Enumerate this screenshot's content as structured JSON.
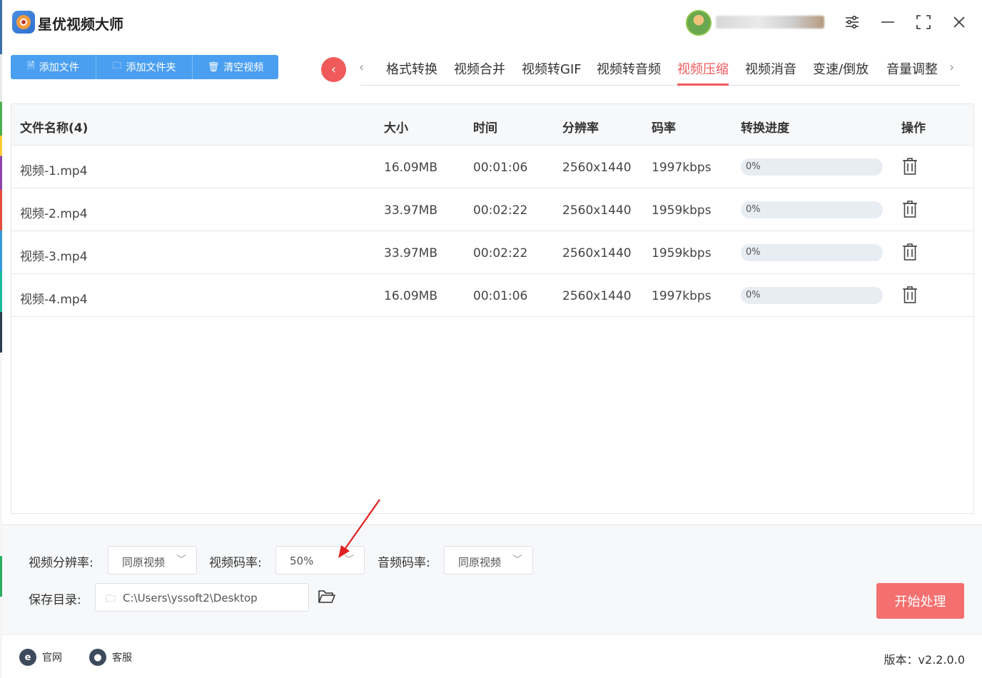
{
  "app": {
    "title": "星优视频大师"
  },
  "user": {
    "name": "ad"
  },
  "toolbar": {
    "add_file": "添加文件",
    "add_folder": "添加文件夹",
    "clear": "清空视频"
  },
  "tabs": [
    {
      "label": "格式转换"
    },
    {
      "label": "视频合并"
    },
    {
      "label": "视频转GIF"
    },
    {
      "label": "视频转音频"
    },
    {
      "label": "视频压缩",
      "active": true
    },
    {
      "label": "视频消音"
    },
    {
      "label": "变速/倒放"
    },
    {
      "label": "音量调整"
    }
  ],
  "table": {
    "columns": [
      "文件名称(4)",
      "大小",
      "时间",
      "分辨率",
      "码率",
      "转换进度",
      "操作"
    ],
    "rows": [
      {
        "name": "视频-1.mp4",
        "size": "16.09MB",
        "duration": "00:01:06",
        "resolution": "2560x1440",
        "bitrate": "1997kbps",
        "progress": "0%",
        "progress_value": 0
      },
      {
        "name": "视频-2.mp4",
        "size": "33.97MB",
        "duration": "00:02:22",
        "resolution": "2560x1440",
        "bitrate": "1959kbps",
        "progress": "0%",
        "progress_value": 0
      },
      {
        "name": "视频-3.mp4",
        "size": "33.97MB",
        "duration": "00:02:22",
        "resolution": "2560x1440",
        "bitrate": "1959kbps",
        "progress": "0%",
        "progress_value": 0
      },
      {
        "name": "视频-4.mp4",
        "size": "16.09MB",
        "duration": "00:01:06",
        "resolution": "2560x1440",
        "bitrate": "1997kbps",
        "progress": "0%",
        "progress_value": 0
      }
    ]
  },
  "settings": {
    "resolution_label": "视频分辨率:",
    "resolution_value": "同原视频",
    "bitrate_label": "视频码率:",
    "bitrate_value": "50%",
    "audio_label": "音频码率:",
    "audio_value": "同原视频",
    "save_label": "保存目录:",
    "save_path": "C:\\Users\\yssoft2\\Desktop",
    "start_button": "开始处理"
  },
  "footer": {
    "website": "官网",
    "support": "客服",
    "version": "版本：v2.2.0.0"
  },
  "colors": {
    "accent_blue": "#4a9ff0",
    "accent_red": "#f05a5a",
    "start_button": "#f46f6f"
  }
}
